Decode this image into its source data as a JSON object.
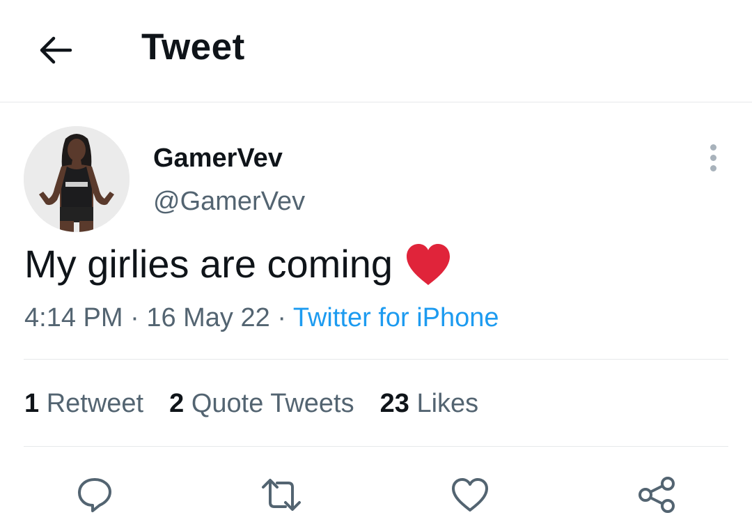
{
  "header": {
    "back_icon": "arrow-left-icon",
    "title": "Tweet"
  },
  "author": {
    "display_name": "GamerVev",
    "handle": "@GamerVev",
    "avatar": "profile-photo"
  },
  "tweet": {
    "text": "My girlies are coming",
    "emoji": "red-heart",
    "time": "4:14 PM",
    "separator": "·",
    "date": "16 May 22",
    "source": "Twitter for iPhone"
  },
  "stats": {
    "retweets_count": "1",
    "retweets_label": "Retweet",
    "quotes_count": "2",
    "quotes_label": "Quote Tweets",
    "likes_count": "23",
    "likes_label": "Likes"
  },
  "actions": {
    "reply_icon": "reply-icon",
    "retweet_icon": "retweet-icon",
    "like_icon": "heart-icon",
    "share_icon": "share-icon"
  },
  "colors": {
    "text_primary": "#0f1419",
    "text_secondary": "#536471",
    "link": "#1d9bf0",
    "divider": "#e6e8ea",
    "heart_emoji": "#e0243a"
  }
}
